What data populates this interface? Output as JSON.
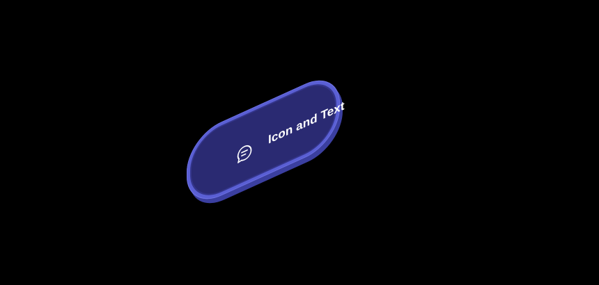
{
  "button": {
    "label": "Icon and Text",
    "icon": "chat-bubble-icon"
  },
  "colors": {
    "background": "#000000",
    "face": "#2a2a72",
    "rim": "#5a5fd4",
    "side": "#3b3fa0",
    "text": "#ffffff"
  }
}
